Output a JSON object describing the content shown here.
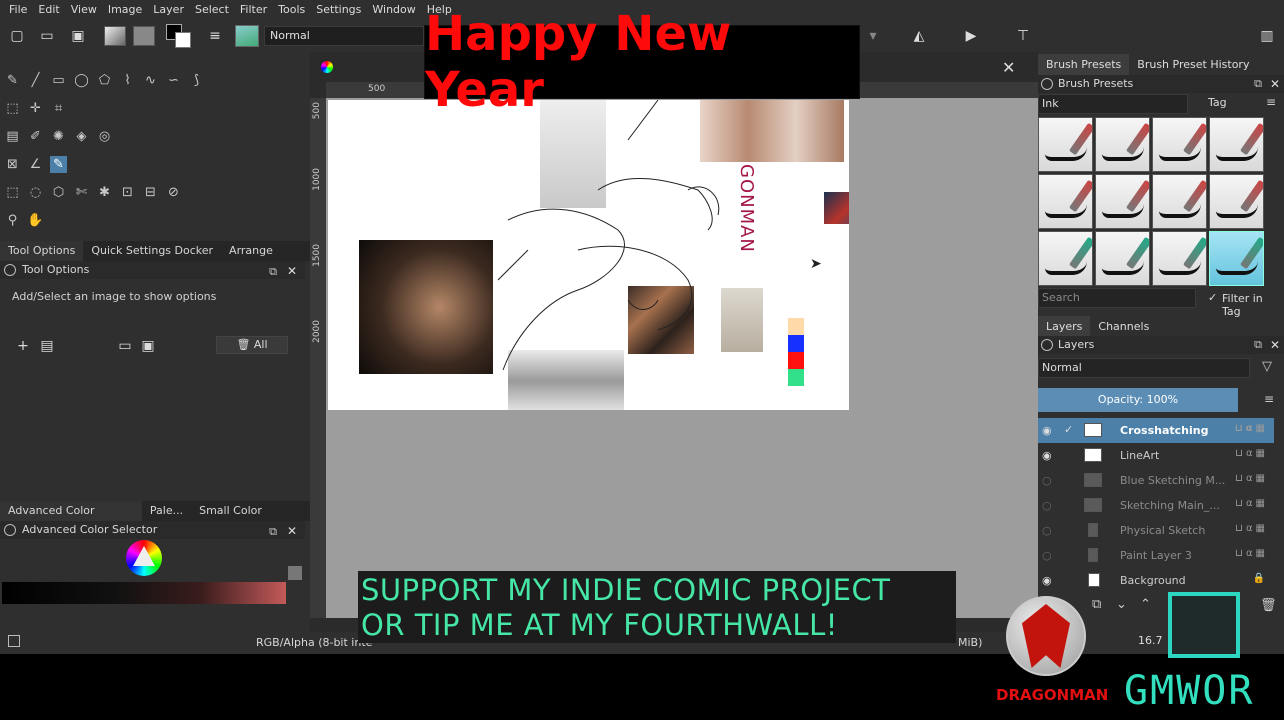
{
  "menubar": [
    "File",
    "Edit",
    "View",
    "Image",
    "Layer",
    "Select",
    "Filter",
    "Tools",
    "Settings",
    "Window",
    "Help"
  ],
  "toolbar": {
    "blend_mode": "Normal"
  },
  "banner": {
    "text": "Happy New Year"
  },
  "left_panel": {
    "tabs": [
      "Tool Options",
      "Quick Settings Docker",
      "Arrange"
    ],
    "tool_options_title": "Tool Options",
    "hint": "Add/Select an image to show options",
    "all_button": "All",
    "bottom_tabs": [
      "Advanced Color Selec...",
      "Pale...",
      "Small Color Selec..."
    ],
    "color_selector_title": "Advanced Color Selector"
  },
  "canvas": {
    "ruler_top": [
      "500"
    ],
    "ruler_left": [
      "500",
      "1000",
      "1500",
      "2000"
    ],
    "vertical_text": "GONMAN",
    "swatches": [
      "#ffd9a8",
      "#1530ff",
      "#ff1010",
      "#33e08a"
    ]
  },
  "status": {
    "left": "RGB/Alpha (8-bit inte",
    "right": "MiB)",
    "zoom": "16.7"
  },
  "right_panel": {
    "top_tabs": [
      "Brush Presets",
      "Brush Preset History"
    ],
    "brush_presets_title": "Brush Presets",
    "tag_combo": "Ink",
    "tag_label": "Tag",
    "search_placeholder": "Search",
    "filter_in_tag": "Filter in Tag",
    "layer_tabs": [
      "Layers",
      "Channels"
    ],
    "layers_title": "Layers",
    "layer_blend": "Normal",
    "opacity": "Opacity:  100%",
    "layers": [
      {
        "name": "Crosshatching",
        "visible": true,
        "selected": true
      },
      {
        "name": "LineArt",
        "visible": true,
        "selected": false
      },
      {
        "name": "Blue Sketching M...",
        "visible": false,
        "selected": false
      },
      {
        "name": "Sketching Main_...",
        "visible": false,
        "selected": false
      },
      {
        "name": "Physical Sketch",
        "visible": false,
        "selected": false
      },
      {
        "name": "Paint Layer 3",
        "visible": false,
        "selected": false
      },
      {
        "name": "Background",
        "visible": true,
        "selected": false
      }
    ]
  },
  "overlay": {
    "support_line1": "SUPPORT MY INDIE COMIC PROJECT",
    "support_line2": "OR TIP ME AT MY FOURTHWALL!",
    "logo_text": "DRAGONMAN",
    "gmwor_text": "GMWOR"
  }
}
